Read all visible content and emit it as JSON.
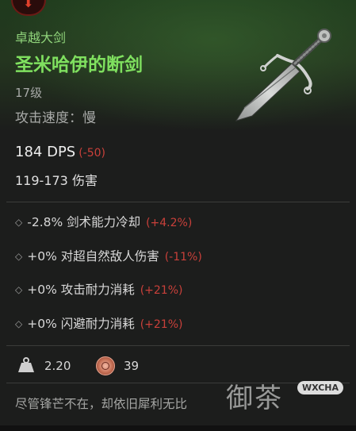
{
  "item": {
    "rarity": "卓越大剑",
    "name": "圣米哈伊的断剑",
    "level": "17级",
    "attack_speed": "攻击速度：慢",
    "dps": "184 DPS",
    "dps_delta": "(-50)",
    "damage": "119-173 伤害"
  },
  "affixes": [
    {
      "text": "-2.8% 剑术能力冷却",
      "change": "(+4.2%)"
    },
    {
      "text": "+0% 对超自然敌人伤害",
      "change": "(-11%)"
    },
    {
      "text": "+0% 攻击耐力消耗",
      "change": "(+21%)"
    },
    {
      "text": "+0% 闪避耐力消耗",
      "change": "(+21%)"
    }
  ],
  "stats": {
    "weight": "2.20",
    "value": "39"
  },
  "flavor": "尽管锋芒不在，却依旧犀利无比",
  "watermark": {
    "text": "御茶",
    "badge": "WXCHA"
  },
  "icons": {
    "top_badge": "down-arrow-icon",
    "weight": "weight-icon",
    "value": "coin-icon",
    "item": "sword-icon"
  },
  "colors": {
    "name": "#7fe05f",
    "rarity": "#8fd37a",
    "negative": "#c9403a"
  }
}
